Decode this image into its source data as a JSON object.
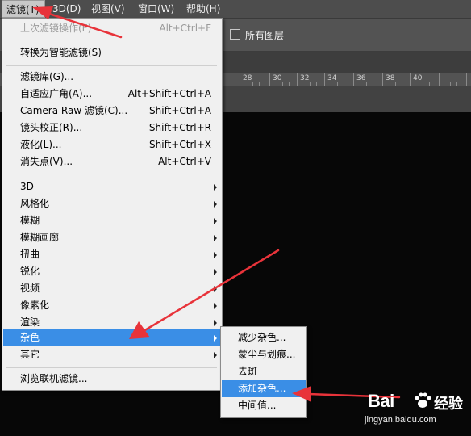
{
  "menubar": {
    "items": [
      {
        "label": "滤镜(T)"
      },
      {
        "label": "3D(D)"
      },
      {
        "label": "视图(V)"
      },
      {
        "label": "窗口(W)"
      },
      {
        "label": "帮助(H)"
      }
    ]
  },
  "options": {
    "all_layers_label": "所有图层"
  },
  "ruler": {
    "numbers": [
      "28",
      "30",
      "32",
      "34",
      "36",
      "38",
      "40"
    ]
  },
  "filter_menu": {
    "items": [
      {
        "label": "上次滤镜操作(F)",
        "shortcut": "Alt+Ctrl+F"
      },
      {
        "label": "转换为智能滤镜(S)",
        "shortcut": ""
      },
      {
        "label": "滤镜库(G)...",
        "shortcut": ""
      },
      {
        "label": "自适应广角(A)...",
        "shortcut": "Alt+Shift+Ctrl+A"
      },
      {
        "label": "Camera Raw 滤镜(C)...",
        "shortcut": "Shift+Ctrl+A"
      },
      {
        "label": "镜头校正(R)...",
        "shortcut": "Shift+Ctrl+R"
      },
      {
        "label": "液化(L)...",
        "shortcut": "Shift+Ctrl+X"
      },
      {
        "label": "消失点(V)...",
        "shortcut": "Alt+Ctrl+V"
      },
      {
        "label": "3D",
        "shortcut": ""
      },
      {
        "label": "风格化",
        "shortcut": ""
      },
      {
        "label": "模糊",
        "shortcut": ""
      },
      {
        "label": "模糊画廊",
        "shortcut": ""
      },
      {
        "label": "扭曲",
        "shortcut": ""
      },
      {
        "label": "锐化",
        "shortcut": ""
      },
      {
        "label": "视频",
        "shortcut": ""
      },
      {
        "label": "像素化",
        "shortcut": ""
      },
      {
        "label": "渲染",
        "shortcut": ""
      },
      {
        "label": "杂色",
        "shortcut": ""
      },
      {
        "label": "其它",
        "shortcut": ""
      },
      {
        "label": "浏览联机滤镜...",
        "shortcut": ""
      }
    ]
  },
  "noise_submenu": {
    "items": [
      {
        "label": "减少杂色..."
      },
      {
        "label": "蒙尘与划痕..."
      },
      {
        "label": "去斑"
      },
      {
        "label": "添加杂色..."
      },
      {
        "label": "中间值..."
      }
    ]
  },
  "watermark": {
    "brand": "Bai",
    "brand_cn": "经验",
    "url": "jingyan.baidu.com"
  },
  "colors": {
    "highlight": "#3a8ee6",
    "annotation_arrow": "#e8333a"
  }
}
